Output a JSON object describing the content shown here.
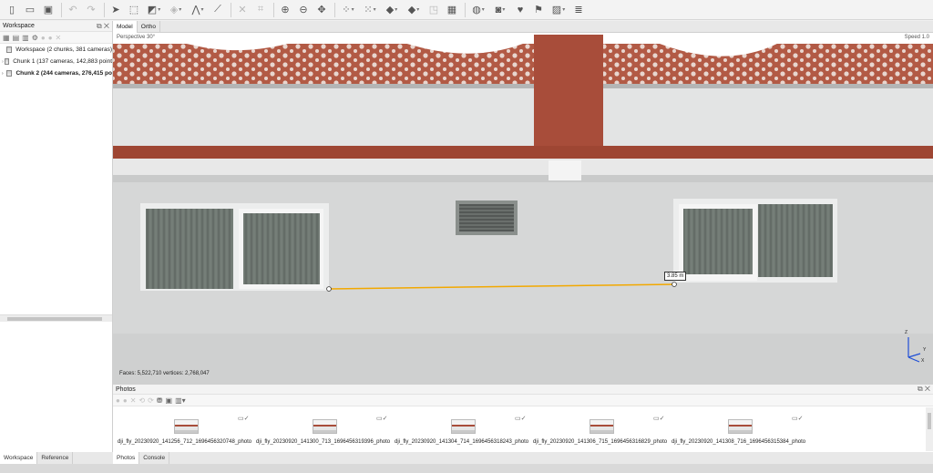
{
  "toolbar": {
    "icons": [
      "new-file-icon",
      "open-folder-icon",
      "save-icon",
      "undo-icon",
      "redo-icon",
      "navigation-icon",
      "rectangle-selection-icon",
      "selection-dropdown-icon",
      "paint-dropdown-icon",
      "draw-dropdown-icon",
      "ruler-icon",
      "delete-icon",
      "crop-icon",
      "zoom-in-icon",
      "zoom-out-icon",
      "move-icon",
      "points-dropdown-icon",
      "dense-cloud-dropdown-icon",
      "model-dropdown-icon",
      "texture-dropdown-icon",
      "tiled-model-icon",
      "dem-icon",
      "camera-dropdown-icon",
      "markers-icon",
      "flag-icon",
      "image-icon",
      "layers-icon"
    ]
  },
  "workspace": {
    "title": "Workspace",
    "items": [
      {
        "label": "Workspace (2 chunks, 381 cameras)",
        "bold": false
      },
      {
        "label": "Chunk 1 (137 cameras, 142,883 point",
        "bold": false
      },
      {
        "label": "Chunk 2 (244 cameras, 276,415 po",
        "bold": true
      }
    ]
  },
  "left_tabs": [
    "Workspace",
    "Reference"
  ],
  "view": {
    "tabs": [
      "Model",
      "Ortho"
    ],
    "top_left": "Perspective 30°",
    "top_right": "Speed 1.0",
    "stats": "Faces: 5,522,710 vertices: 2,768,047",
    "measurement": "3.85 m",
    "axis_labels": [
      "Z",
      "Y",
      "X"
    ],
    "colors": {
      "wall": "#dcdcdc",
      "red_trim": "#a84d3a",
      "measure_line": "#f2a800"
    }
  },
  "photos": {
    "title": "Photos",
    "tabs": [
      "Photos",
      "Console"
    ],
    "items": [
      {
        "caption": "dji_fly_20230920_141256_712_1696456320748_photo"
      },
      {
        "caption": "dji_fly_20230920_141300_713_1696456319396_photo"
      },
      {
        "caption": "dji_fly_20230920_141304_714_1696456318243_photo"
      },
      {
        "caption": "dji_fly_20230920_141306_715_1696456316829_photo"
      },
      {
        "caption": "dji_fly_20230920_141308_716_1696456315384_photo"
      }
    ]
  }
}
